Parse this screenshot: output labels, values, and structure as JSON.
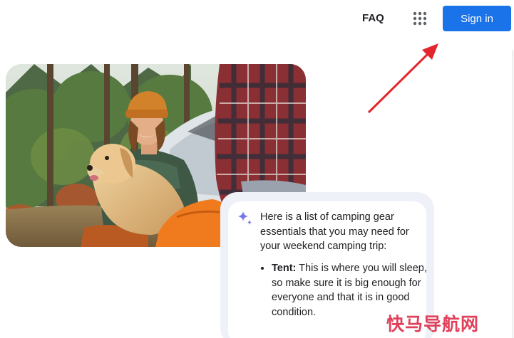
{
  "header": {
    "faq_label": "FAQ",
    "apps_icon": "apps-grid-icon",
    "sign_in_label": "Sign in",
    "accent_color": "#1a73e8"
  },
  "annotation": {
    "arrow_color": "#e3262b"
  },
  "hero": {
    "image": "camping-photo-woman-with-golden-retriever"
  },
  "chat": {
    "icon": "sparkle-icon",
    "intro": "Here is a list of camping gear essentials that you may need for your weekend camping trip:",
    "items": [
      {
        "term": "Tent:",
        "text": " This is where you will sleep, so make sure it is big enough for everyone and that it is in good condition."
      }
    ]
  },
  "watermark": {
    "text": "快马导航网"
  }
}
